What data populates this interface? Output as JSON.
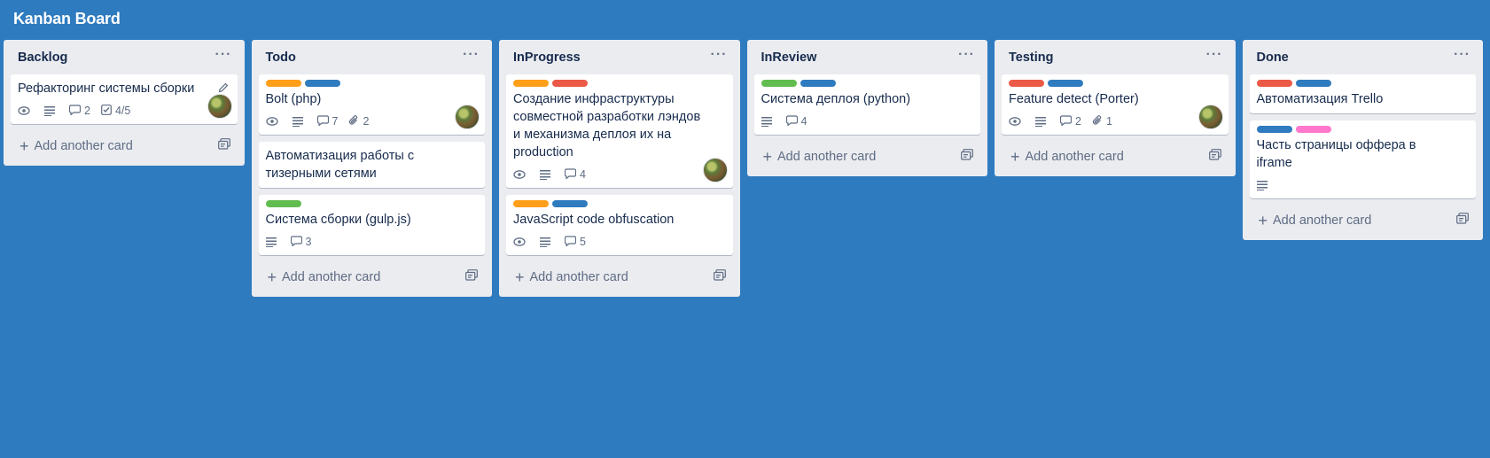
{
  "board": {
    "title": "Kanban Board"
  },
  "colors": {
    "orange": "#ff9f1a",
    "blue": "#2f7bbf",
    "red": "#eb5a46",
    "green": "#61bd4f",
    "pink": "#ff78cb",
    "background": "#2f7bbf"
  },
  "add_card_label": "Add another card",
  "lists": [
    {
      "title": "Backlog",
      "cards": [
        {
          "title": "Рефакторинг системы сборки",
          "labels": [],
          "watch": true,
          "description": true,
          "comments": "2",
          "checklist": "4/5",
          "attachments": "",
          "avatar": true,
          "edit": true
        }
      ]
    },
    {
      "title": "Todo",
      "cards": [
        {
          "title": "Bolt (php)",
          "labels": [
            "orange",
            "blue"
          ],
          "watch": true,
          "description": true,
          "comments": "7",
          "attachments": "2",
          "avatar": true
        },
        {
          "title": "Автоматизация работы с тизерными сетями",
          "labels": []
        },
        {
          "title": "Система сборки (gulp.js)",
          "labels": [
            "green"
          ],
          "description": true,
          "comments": "3"
        }
      ]
    },
    {
      "title": "InProgress",
      "cards": [
        {
          "title": "Создание инфраструктуры совместной разработки лэндов и механизма деплоя их на production",
          "labels": [
            "orange",
            "red"
          ],
          "watch": true,
          "description": true,
          "comments": "4",
          "avatar": true
        },
        {
          "title": "JavaScript code obfuscation",
          "labels": [
            "orange",
            "blue"
          ],
          "watch": true,
          "description": true,
          "comments": "5"
        }
      ]
    },
    {
      "title": "InReview",
      "cards": [
        {
          "title": "Система деплоя (python)",
          "labels": [
            "green",
            "blue"
          ],
          "description": true,
          "comments": "4"
        }
      ]
    },
    {
      "title": "Testing",
      "cards": [
        {
          "title": "Feature detect (Porter)",
          "labels": [
            "red",
            "blue"
          ],
          "watch": true,
          "description": true,
          "comments": "2",
          "attachments": "1",
          "avatar": true
        }
      ]
    },
    {
      "title": "Done",
      "cards": [
        {
          "title": "Автоматизация Trello",
          "labels": [
            "red",
            "blue"
          ]
        },
        {
          "title": "Часть страницы оффера в iframe",
          "labels": [
            "blue",
            "pink"
          ],
          "description": true
        }
      ]
    }
  ]
}
